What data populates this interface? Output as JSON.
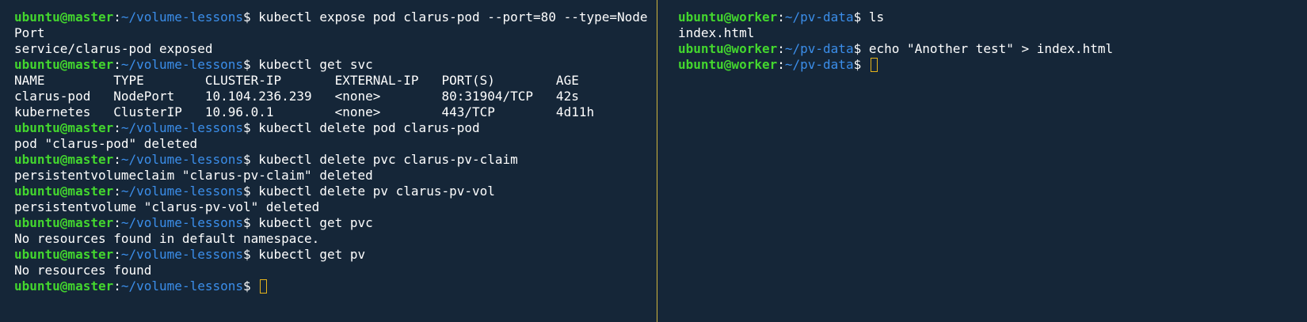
{
  "theme": {
    "background": "#152638",
    "user_color": "#43d62e",
    "path_color": "#3b8eea",
    "divider_color": "#d1b63e",
    "cursor_color": "#e5b31c"
  },
  "left_pane": {
    "lines": [
      {
        "type": "prompt",
        "user": "ubuntu@master",
        "path": "~/volume-lessons",
        "command": "kubectl expose pod clarus-pod --port=80 --type=Node"
      },
      {
        "type": "output",
        "text": "Port"
      },
      {
        "type": "output",
        "text": "service/clarus-pod exposed"
      },
      {
        "type": "prompt",
        "user": "ubuntu@master",
        "path": "~/volume-lessons",
        "command": "kubectl get svc"
      },
      {
        "type": "output",
        "text": "NAME         TYPE        CLUSTER-IP       EXTERNAL-IP   PORT(S)        AGE"
      },
      {
        "type": "output",
        "text": "clarus-pod   NodePort    10.104.236.239   <none>        80:31904/TCP   42s"
      },
      {
        "type": "output",
        "text": "kubernetes   ClusterIP   10.96.0.1        <none>        443/TCP        4d11h"
      },
      {
        "type": "prompt",
        "user": "ubuntu@master",
        "path": "~/volume-lessons",
        "command": "kubectl delete pod clarus-pod"
      },
      {
        "type": "output",
        "text": "pod \"clarus-pod\" deleted"
      },
      {
        "type": "prompt",
        "user": "ubuntu@master",
        "path": "~/volume-lessons",
        "command": "kubectl delete pvc clarus-pv-claim"
      },
      {
        "type": "output",
        "text": "persistentvolumeclaim \"clarus-pv-claim\" deleted"
      },
      {
        "type": "prompt",
        "user": "ubuntu@master",
        "path": "~/volume-lessons",
        "command": "kubectl delete pv clarus-pv-vol"
      },
      {
        "type": "output",
        "text": "persistentvolume \"clarus-pv-vol\" deleted"
      },
      {
        "type": "prompt",
        "user": "ubuntu@master",
        "path": "~/volume-lessons",
        "command": "kubectl get pvc"
      },
      {
        "type": "output",
        "text": "No resources found in default namespace."
      },
      {
        "type": "prompt",
        "user": "ubuntu@master",
        "path": "~/volume-lessons",
        "command": "kubectl get pv"
      },
      {
        "type": "output",
        "text": "No resources found"
      },
      {
        "type": "prompt",
        "user": "ubuntu@master",
        "path": "~/volume-lessons",
        "command": "",
        "cursor": true
      }
    ]
  },
  "right_pane": {
    "lines": [
      {
        "type": "prompt",
        "user": "ubuntu@worker",
        "path": "~/pv-data",
        "command": "ls"
      },
      {
        "type": "output",
        "text": "index.html"
      },
      {
        "type": "prompt",
        "user": "ubuntu@worker",
        "path": "~/pv-data",
        "command": "echo \"Another test\" > index.html"
      },
      {
        "type": "prompt",
        "user": "ubuntu@worker",
        "path": "~/pv-data",
        "command": "",
        "cursor": true
      }
    ]
  }
}
